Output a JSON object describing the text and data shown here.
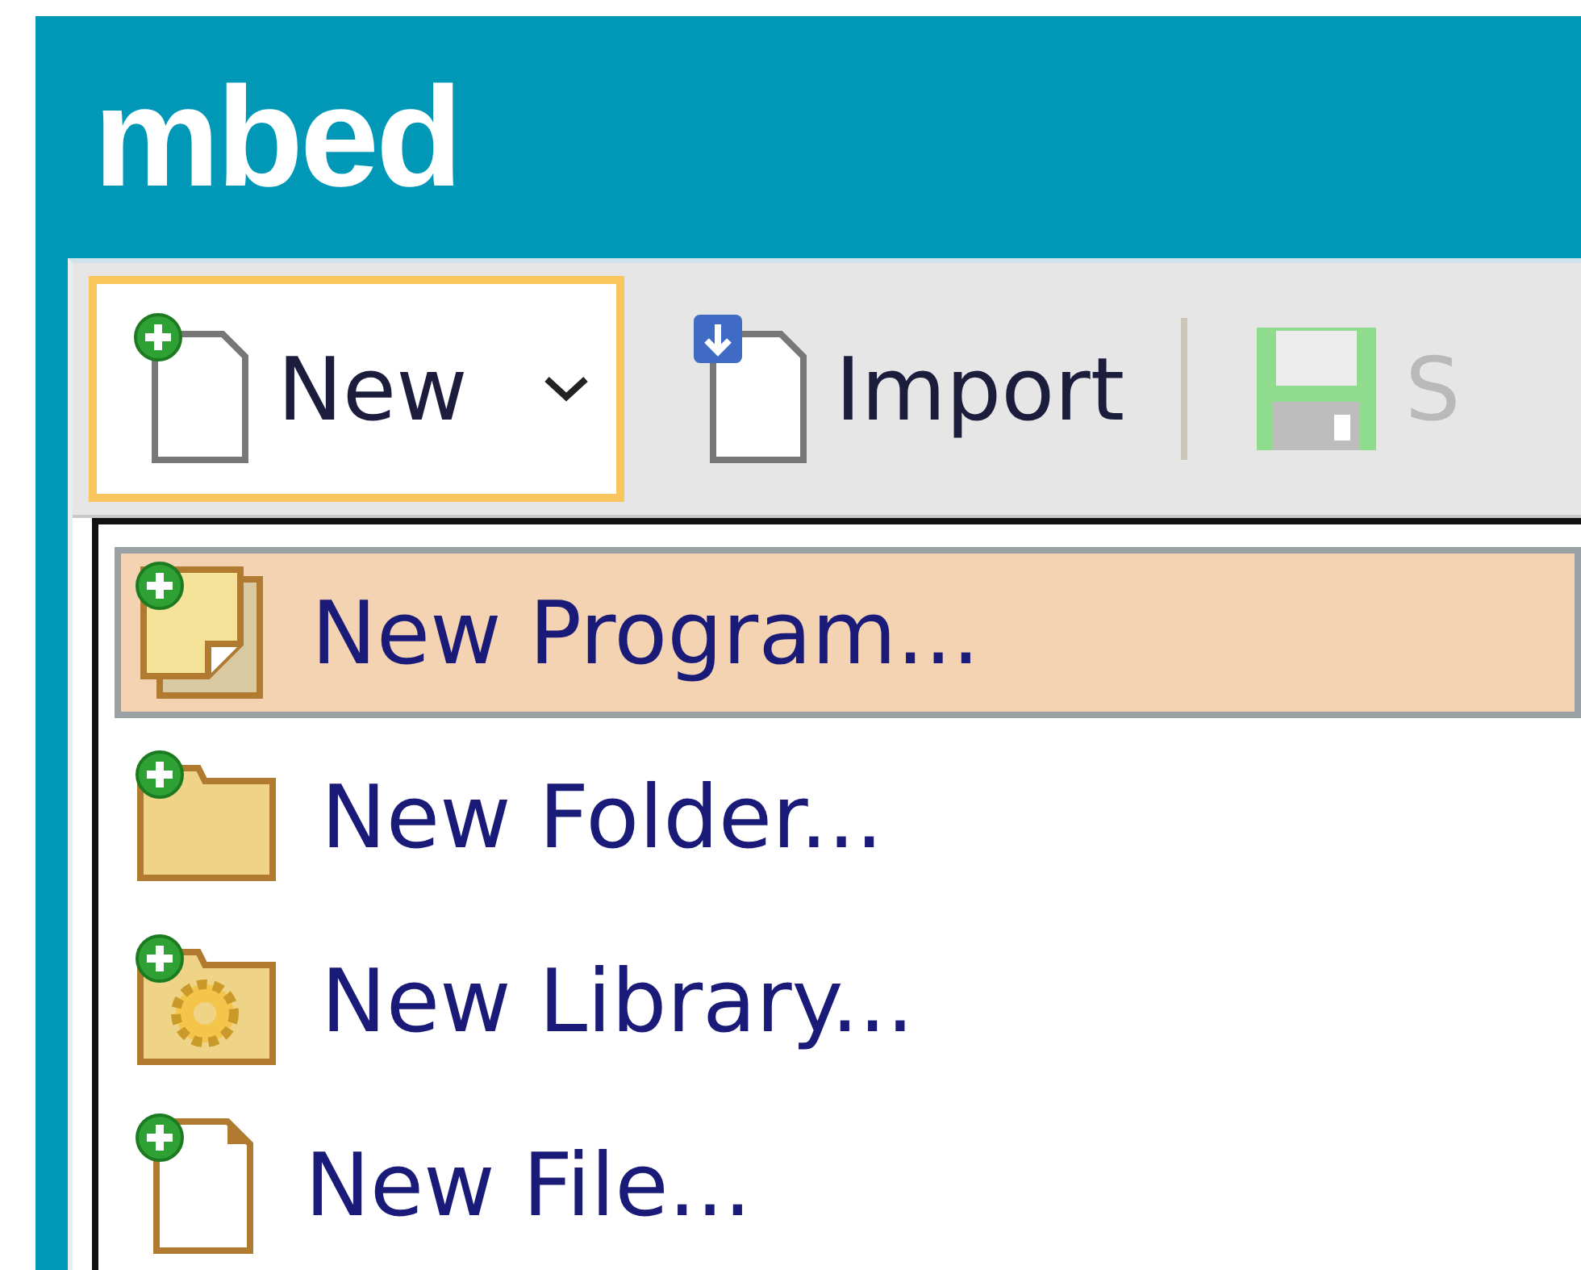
{
  "header": {
    "logo": "mbed"
  },
  "toolbar": {
    "buttons": [
      {
        "kind": "new",
        "label": "New",
        "selected": true
      },
      {
        "kind": "import",
        "label": "Import",
        "selected": false
      },
      {
        "kind": "save",
        "label": "S",
        "selected": false,
        "disabled": true
      }
    ]
  },
  "menu": {
    "items": [
      {
        "kind": "program",
        "label": "New Program...",
        "selected": true
      },
      {
        "kind": "folder",
        "label": "New Folder...",
        "selected": false
      },
      {
        "kind": "library",
        "label": "New Library...",
        "selected": false
      },
      {
        "kind": "file",
        "label": "New File...",
        "selected": false
      }
    ]
  }
}
